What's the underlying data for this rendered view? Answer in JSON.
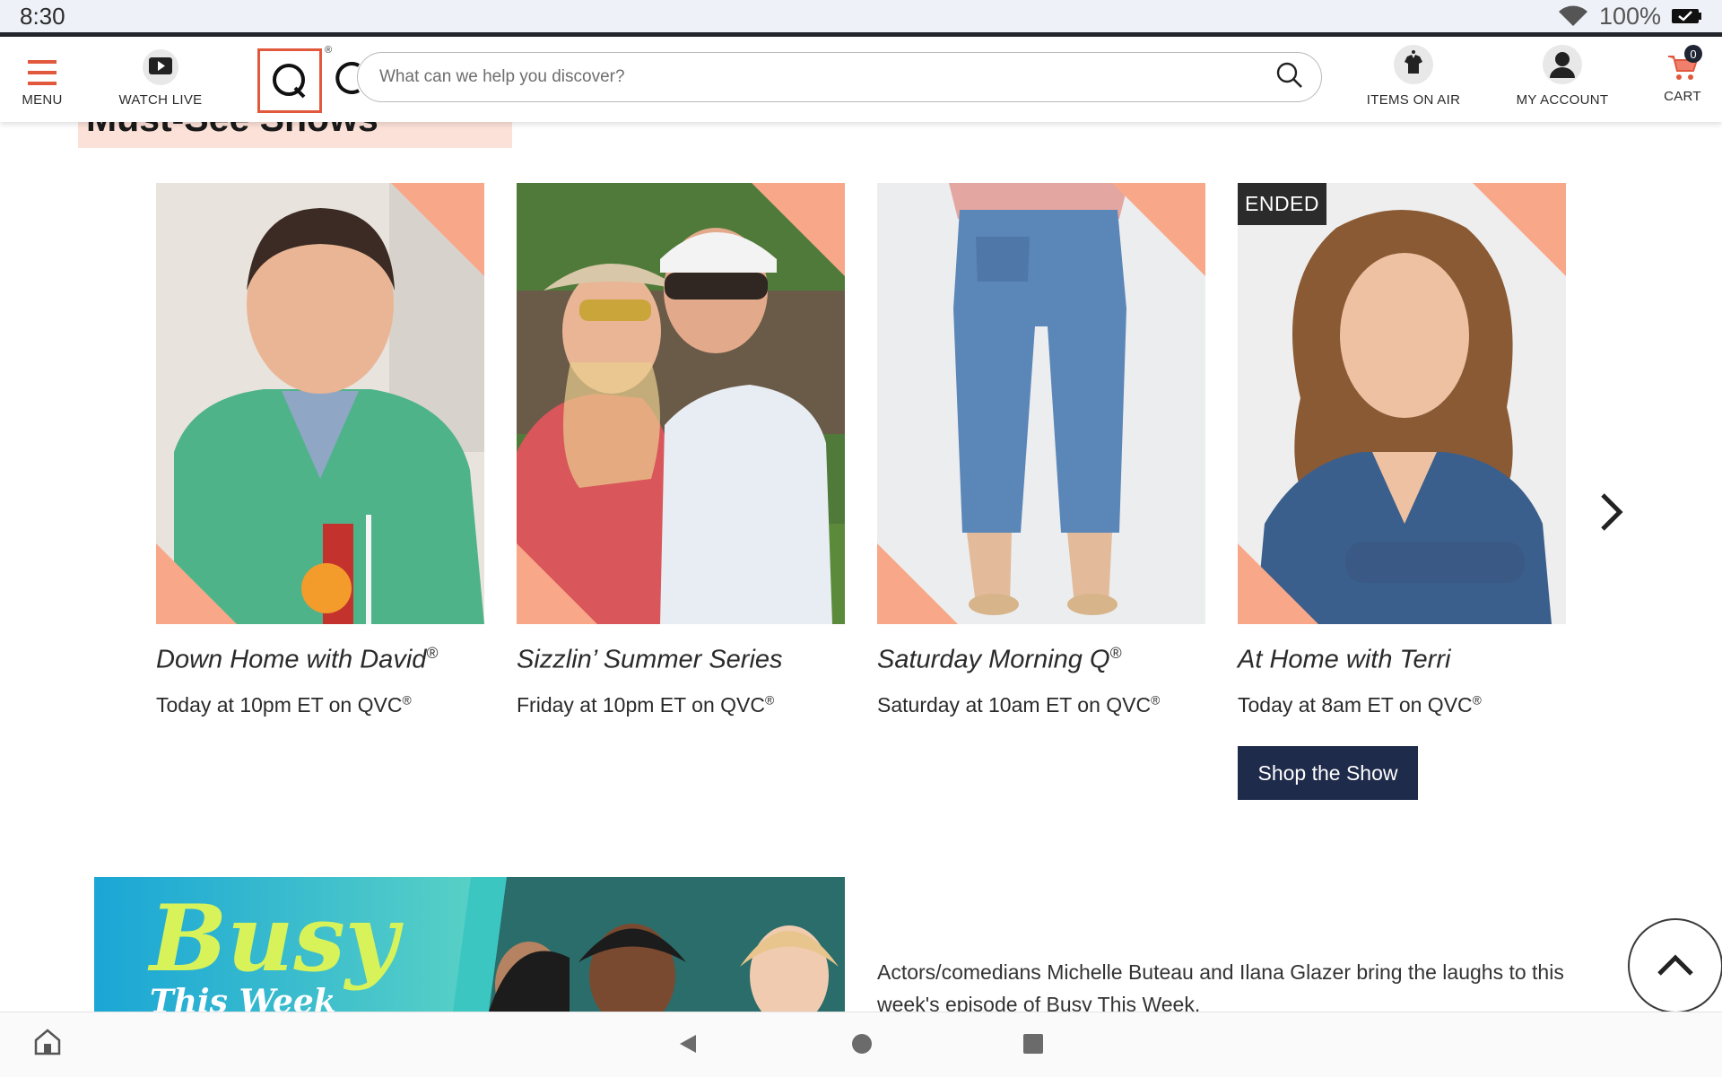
{
  "status_bar": {
    "time": "8:30",
    "battery": "100%"
  },
  "header": {
    "menu_label": "MENU",
    "watch_live_label": "WATCH LIVE",
    "logo_alt": "Q",
    "search_placeholder": "What can we help you discover?",
    "items_on_air_label": "ITEMS ON AIR",
    "my_account_label": "MY ACCOUNT",
    "cart_label": "CART",
    "cart_count": "0"
  },
  "section": {
    "title": "Must-See Shows"
  },
  "shows": [
    {
      "title": "Down Home with David",
      "reg": "®",
      "time": "Today at 10pm ET on QVC",
      "time_reg": "®"
    },
    {
      "title": "Sizzlin’ Summer Series",
      "reg": "",
      "time": "Friday at 10pm ET on QVC",
      "time_reg": "®"
    },
    {
      "title": "Saturday Morning Q",
      "reg": "®",
      "time": "Saturday at 10am ET on QVC",
      "time_reg": "®"
    },
    {
      "title": "At Home with Terri",
      "reg": "",
      "time": "Today at 8am ET on QVC",
      "time_reg": "®",
      "badge": "ENDED",
      "button": "Shop the Show"
    }
  ],
  "feature": {
    "banner_title": "Busy",
    "banner_subtitle": "This Week",
    "description": "Actors/comedians Michelle Buteau and Ilana Glazer bring the laughs to this week's episode of Busy This Week."
  },
  "colors": {
    "accent_corner": "#f8a889",
    "logo_border": "#e1583c",
    "button_bg": "#1f2b4a",
    "title_highlight": "#fce1d8"
  },
  "icons": [
    "menu-icon",
    "play-icon",
    "search-icon",
    "items-on-air-icon",
    "account-icon",
    "cart-icon",
    "chevron-right-icon",
    "chevron-up-icon",
    "wifi-icon",
    "battery-icon",
    "home-icon",
    "back-icon",
    "home-circle-icon",
    "recents-icon"
  ]
}
